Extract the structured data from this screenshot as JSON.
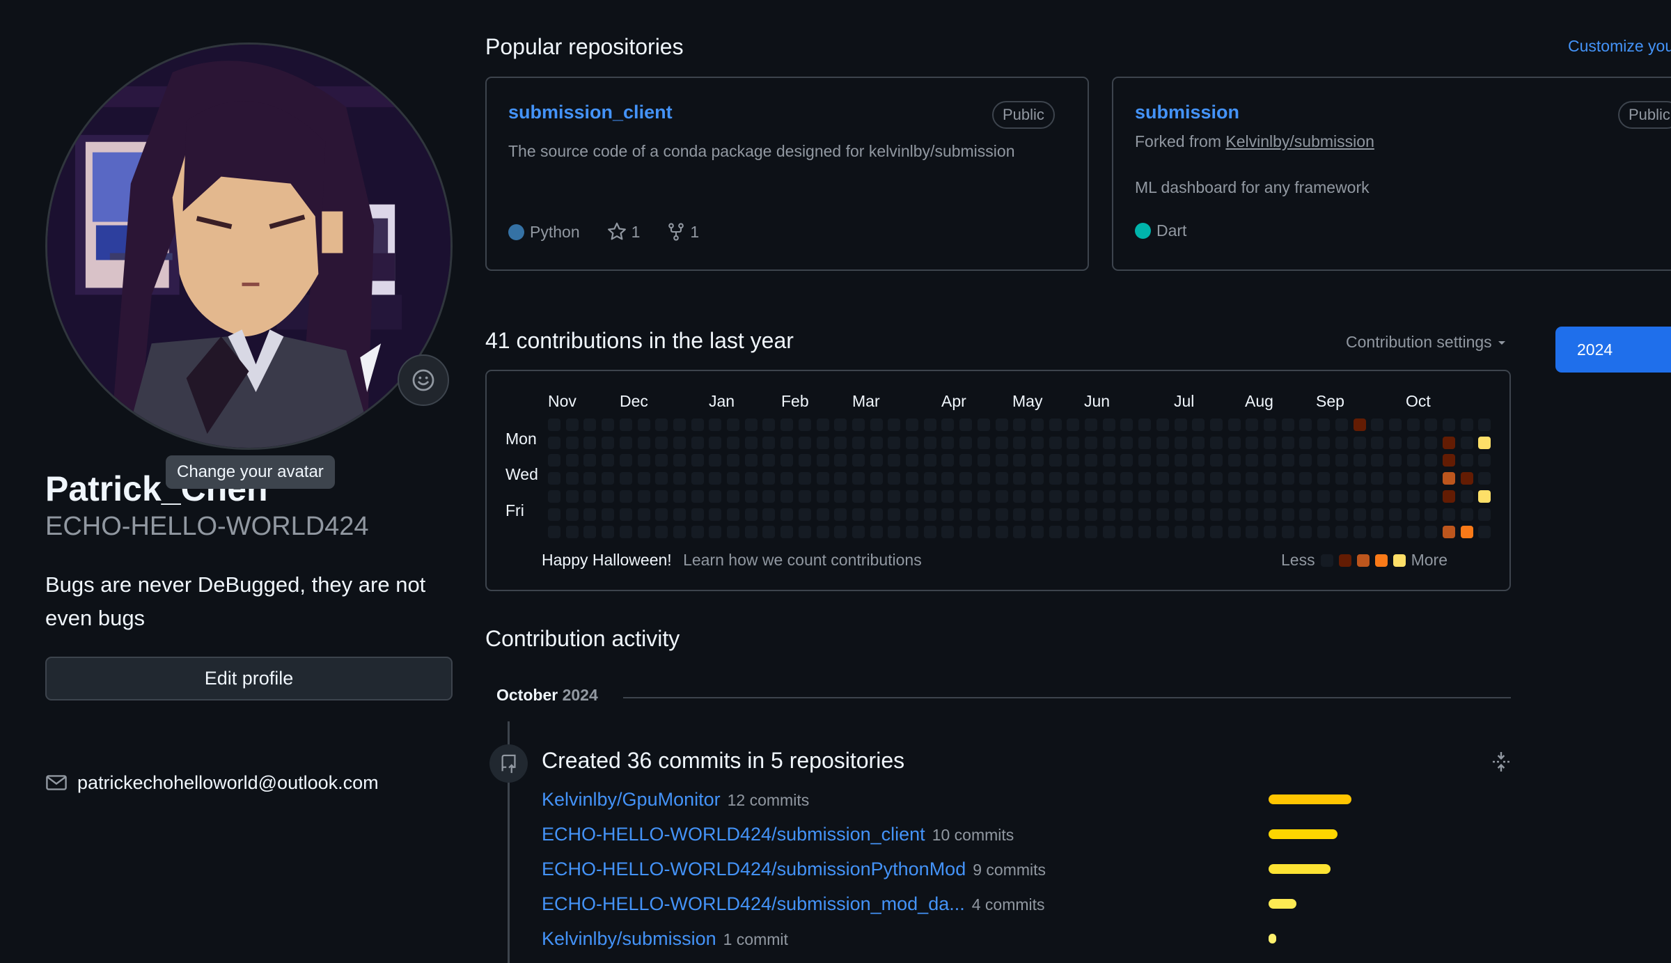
{
  "profile": {
    "name": "Patrick_Chen",
    "login": "ECHO-HELLO-WORLD424",
    "bio": "Bugs are never DeBugged, they are not even bugs",
    "edit_label": "Edit profile",
    "email": "patrickechohelloworld@outlook.com",
    "avatar_tooltip": "Change your avatar"
  },
  "popular": {
    "title": "Popular repositories",
    "customize_label": "Customize your pins",
    "repos": [
      {
        "name": "submission_client",
        "visibility": "Public",
        "description": "The source code of a conda package designed for kelvinlby/submission",
        "language": "Python",
        "language_color": "#3572A5",
        "stars": "1",
        "forks": "1"
      },
      {
        "name": "submission",
        "visibility": "Public",
        "forked_prefix": "Forked from",
        "forked_from": "Kelvinlby/submission",
        "description": "ML dashboard for any framework",
        "language": "Dart",
        "language_color": "#00B4AB"
      }
    ]
  },
  "contributions": {
    "title": "41 contributions in the last year",
    "settings_label": "Contribution settings",
    "year": "2024",
    "months": [
      "Nov",
      "Dec",
      "Jan",
      "Feb",
      "Mar",
      "Apr",
      "May",
      "Jun",
      "Jul",
      "Aug",
      "Sep",
      "Oct"
    ],
    "days": [
      "Mon",
      "Wed",
      "Fri"
    ],
    "halloween": "Happy Halloween!",
    "learn_link": "Learn how we count contributions",
    "less": "Less",
    "more": "More",
    "level_colors": [
      "#151b23",
      "#631c03",
      "#bd561d",
      "#fa7a18",
      "#fddf68"
    ],
    "active_cells": [
      {
        "week": 45,
        "day": 0,
        "level": 1
      },
      {
        "week": 50,
        "day": 1,
        "level": 1
      },
      {
        "week": 50,
        "day": 2,
        "level": 1
      },
      {
        "week": 50,
        "day": 3,
        "level": 2
      },
      {
        "week": 50,
        "day": 4,
        "level": 1
      },
      {
        "week": 50,
        "day": 6,
        "level": 2
      },
      {
        "week": 51,
        "day": 3,
        "level": 1
      },
      {
        "week": 51,
        "day": 6,
        "level": 3
      },
      {
        "week": 52,
        "day": 1,
        "level": 4
      },
      {
        "week": 52,
        "day": 4,
        "level": 4
      }
    ]
  },
  "activity": {
    "title": "Contribution activity",
    "month": "October",
    "month_year": "2024",
    "summary": "Created 36 commits in 5 repositories",
    "rows": [
      {
        "repo": "Kelvinlby/GpuMonitor",
        "count": "12 commits",
        "commits": 12
      },
      {
        "repo": "ECHO-HELLO-WORLD424/submission_client",
        "count": "10 commits",
        "commits": 10
      },
      {
        "repo": "ECHO-HELLO-WORLD424/submissionPythonMod",
        "count": "9 commits",
        "commits": 9
      },
      {
        "repo": "ECHO-HELLO-WORLD424/submission_mod_da...",
        "count": "4 commits",
        "commits": 4
      },
      {
        "repo": "Kelvinlby/submission",
        "count": "1 commit",
        "commits": 1
      }
    ],
    "bar_colors": [
      "#ffc501",
      "#fdd600",
      "#fde333",
      "#fdeb53",
      "#fdf06d"
    ]
  }
}
